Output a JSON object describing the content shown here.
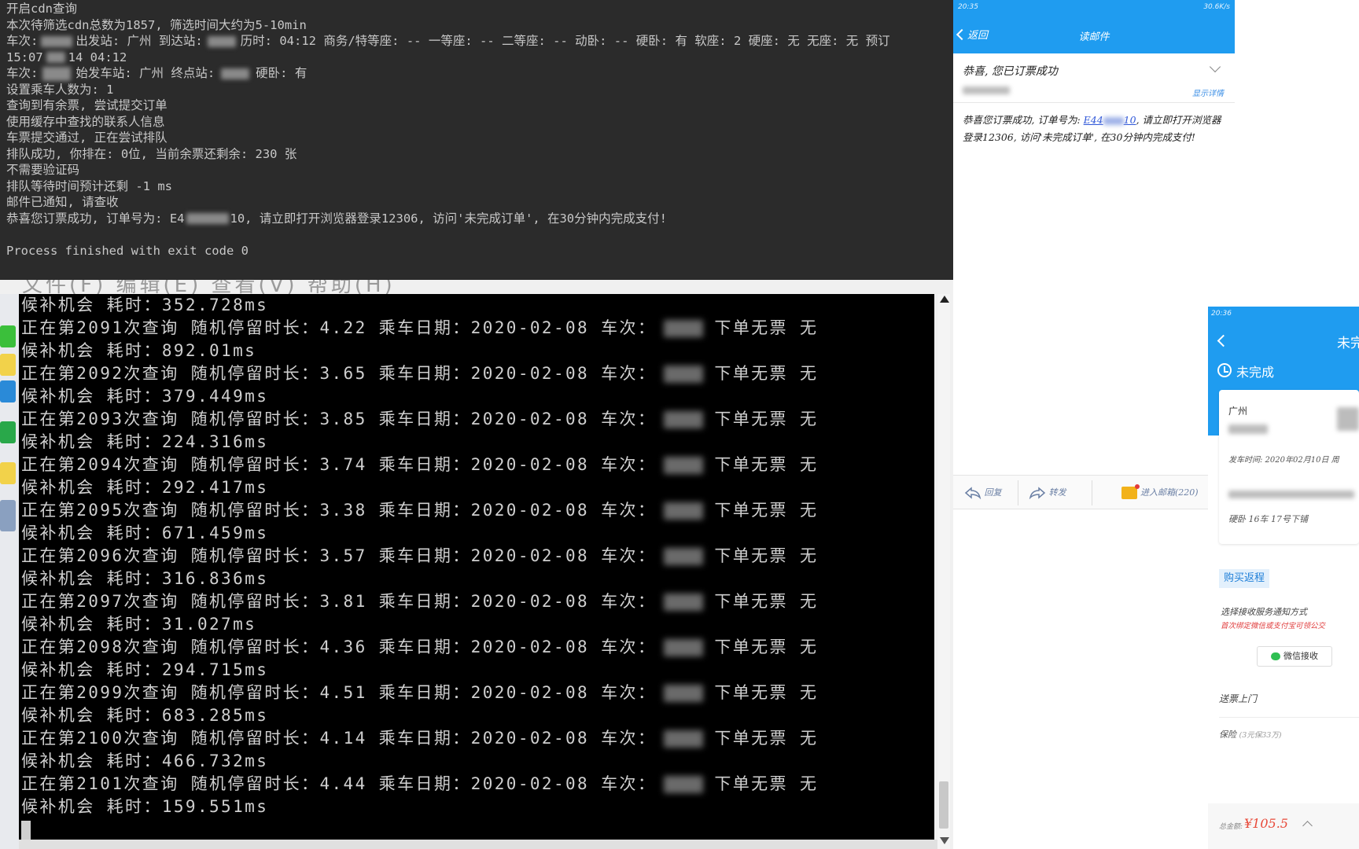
{
  "console_top": {
    "lines": [
      "开启cdn查询",
      "本次待筛选cdn总数为1857, 筛选时间大约为5-10min",
      "车次:",
      "出发站: 广州 到达站:",
      "历时: 04:12 商务/特等座: -- 一等座: -- 二等座: -- 动卧: -- 硬卧: 有 软座: 2 硬座: 无 无座: 无 预订",
      "15:07",
      "14 04:12",
      "车次:",
      "始发车站: 广州 终点站:",
      "硬卧: 有",
      "设置乘车人数为: 1",
      "查询到有余票, 尝试提交订单",
      "使用缓存中查找的联系人信息",
      "车票提交通过, 正在尝试排队",
      "排队成功, 你排在: 0位, 当前余票还剩余: 230 张",
      "不需要验证码",
      "排队等待时间预计还剩 -1 ms",
      "邮件已通知, 请查收",
      "恭喜您订票成功, 订单号为: E4",
      "10, 请立即打开浏览器登录12306, 访问'未完成订单', 在30分钟内完成支付!",
      "Process finished with exit code 0"
    ]
  },
  "console_bottom": {
    "menu_text": "文件(F)   编辑(E)   查看(V)   帮助(H)",
    "first_line": "候补机会 耗时：352.728ms",
    "query_prefix": "正在第",
    "query_mid": "次查询 随机停留时长：",
    "query_date": " 乘车日期：2020-02-08 车次：",
    "query_suffix": "下单无票 无",
    "elapsed_prefix": "候补机会 耗时：",
    "queries": [
      {
        "n": "2091",
        "delay": "4.22",
        "time": "892.01ms"
      },
      {
        "n": "2092",
        "delay": "3.65",
        "time": "379.449ms"
      },
      {
        "n": "2093",
        "delay": "3.85",
        "time": "224.316ms"
      },
      {
        "n": "2094",
        "delay": "3.74",
        "time": "292.417ms"
      },
      {
        "n": "2095",
        "delay": "3.38",
        "time": "671.459ms"
      },
      {
        "n": "2096",
        "delay": "3.57",
        "time": "316.836ms"
      },
      {
        "n": "2097",
        "delay": "3.81",
        "time": "31.027ms"
      },
      {
        "n": "2098",
        "delay": "4.36",
        "time": "294.715ms"
      },
      {
        "n": "2099",
        "delay": "4.51",
        "time": "683.285ms"
      },
      {
        "n": "2100",
        "delay": "4.14",
        "time": "466.732ms"
      },
      {
        "n": "2101",
        "delay": "4.44",
        "time": "159.551ms"
      }
    ]
  },
  "mail": {
    "status_time": "20:35",
    "status_right": "30.6K/s",
    "back_label": "返回",
    "title": "读邮件",
    "subject": "恭喜, 您已订票成功",
    "detail_link": "显示详情",
    "body_before": "恭喜您订票成功, 订单号为: ",
    "body_order_a": "E44",
    "body_order_b": "10",
    "body_after": ", 请立即打开浏览器登录12306, 访问'未完成订单', 在30分钟内完成支付!",
    "toolbar": {
      "reply": "回复",
      "forward": "转发",
      "inbox": "进入邮箱(220)"
    }
  },
  "order": {
    "status_time": "20:36",
    "title": "未完成",
    "status_text": "未完成",
    "from_station": "广州",
    "depart_time": "发车时间: 2020年02月10日 周",
    "seat": "硬卧 16车 17号下铺",
    "return_button": "购买返程",
    "notify_label": "选择接收服务通知方式",
    "notify_sub": "首次绑定微信或支付宝可领公交",
    "wechat_button": "微信接收",
    "delivery": "送票上门",
    "insurance_label": "保险",
    "insurance_sub": "(3元保33万)",
    "total_label": "总金额:",
    "total_value": "¥105.5"
  },
  "colors": {
    "ide_bg": "#2b2b2b",
    "console_bg": "#000000",
    "mail_blue": "#1f9cf0",
    "price_red": "#e84a3a"
  }
}
